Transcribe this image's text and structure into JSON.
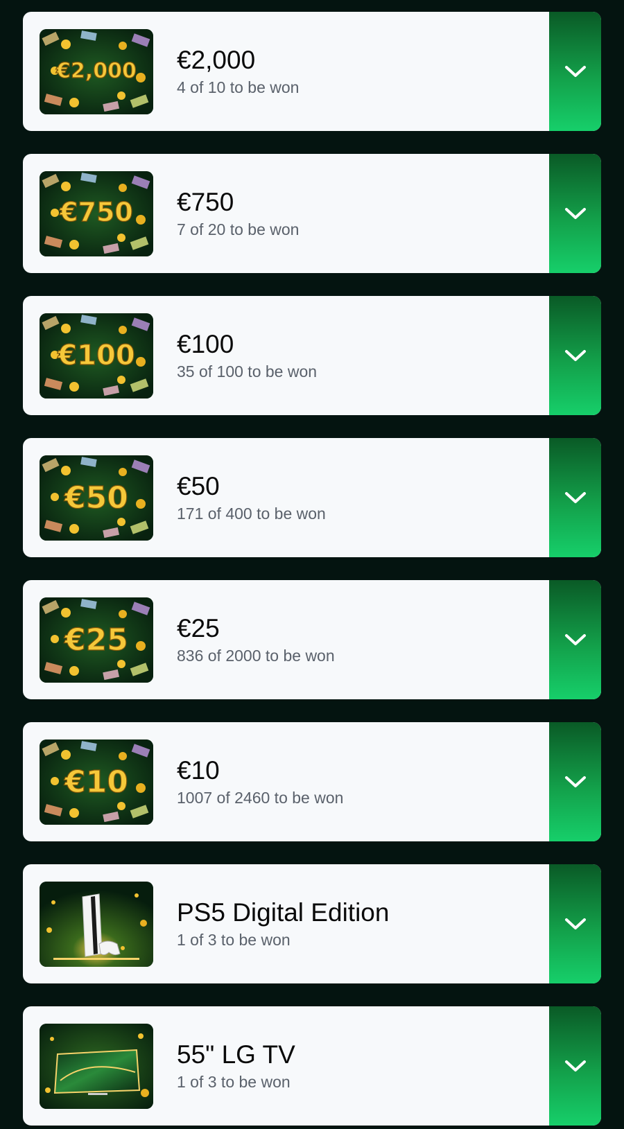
{
  "prizes": [
    {
      "title": "€2,000",
      "subtitle": "4 of 10 to be won",
      "image_label": "€2,000",
      "image_kind": "cash"
    },
    {
      "title": "€750",
      "subtitle": "7 of 20 to be won",
      "image_label": "€750",
      "image_kind": "cash"
    },
    {
      "title": "€100",
      "subtitle": "35 of 100 to be won",
      "image_label": "€100",
      "image_kind": "cash"
    },
    {
      "title": "€50",
      "subtitle": "171 of 400 to be won",
      "image_label": "€50",
      "image_kind": "cash"
    },
    {
      "title": "€25",
      "subtitle": "836 of 2000 to be won",
      "image_label": "€25",
      "image_kind": "cash"
    },
    {
      "title": "€10",
      "subtitle": "1007 of 2460 to be won",
      "image_label": "€10",
      "image_kind": "cash"
    },
    {
      "title": "PS5 Digital Edition",
      "subtitle": "1 of 3 to be won",
      "image_label": "",
      "image_kind": "console"
    },
    {
      "title": "55\" LG TV",
      "subtitle": "1 of 3 to be won",
      "image_label": "",
      "image_kind": "tv"
    }
  ],
  "icons": {
    "expand": "chevron-down-icon"
  },
  "colors": {
    "background": "#041410",
    "card": "#f7f9fb",
    "accent_top": "#0a5a26",
    "accent_bottom": "#16cf6a",
    "gold": "#f2c230"
  }
}
